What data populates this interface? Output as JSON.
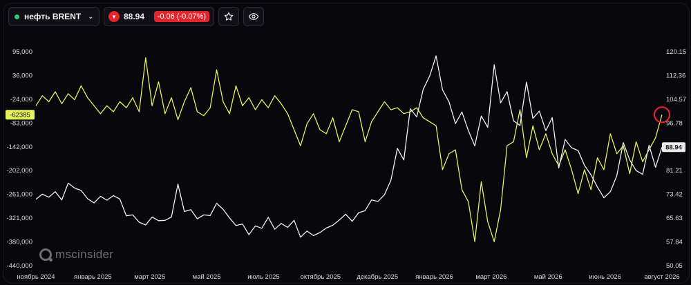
{
  "instrument": {
    "name": "нефть BRENT",
    "status_color": "#2ecc71"
  },
  "quote": {
    "price": "88.94",
    "change": "-0.06 (-0.07%)",
    "direction": "down",
    "down_color": "#e0262c"
  },
  "actions": {
    "favorite_icon": "star-icon",
    "watch_icon": "eye-icon"
  },
  "watermark": "mscinsider",
  "chart_data": {
    "type": "line",
    "x": [
      "ноябрь 2024",
      "январь 2025",
      "март 2025",
      "май 2025",
      "июль 2025",
      "октябрь 2025",
      "декабрь 2025",
      "январь 2026",
      "март 2026",
      "май 2026",
      "июнь 2026",
      "август 2026"
    ],
    "left_axis": {
      "ticks": [
        "95,000",
        "36,000",
        "-24,000",
        "-83,000",
        "-142,000",
        "-202,000",
        "-261,000",
        "-321,000",
        "-380,000",
        "-440,000"
      ],
      "ylim": [
        -440000,
        95000
      ],
      "marker": "-62385"
    },
    "right_axis": {
      "ticks": [
        "120.15",
        "112.36",
        "104.57",
        "96.78",
        "89.00",
        "81.21",
        "73.42",
        "65.63",
        "57.84",
        "50.05"
      ],
      "ylim": [
        50.05,
        120.15
      ],
      "last_price": "88.94"
    },
    "series": [
      {
        "axis": "left",
        "color": "#e6f05a",
        "values": [
          -40000,
          -15000,
          -30000,
          -5000,
          -35000,
          -10000,
          -25000,
          10000,
          -20000,
          -40000,
          -60000,
          -40000,
          -55000,
          -30000,
          -45000,
          -20000,
          -55000,
          80000,
          -40000,
          20000,
          -60000,
          -20000,
          -75000,
          -30000,
          5000,
          -55000,
          -65000,
          -45000,
          50000,
          -30000,
          -60000,
          10000,
          -40000,
          -20000,
          -50000,
          -25000,
          -45000,
          -15000,
          -35000,
          -60000,
          -100000,
          -140000,
          -85000,
          -60000,
          -100000,
          -110000,
          -70000,
          -130000,
          -90000,
          -50000,
          -55000,
          -130000,
          -80000,
          -55000,
          -30000,
          -50000,
          -45000,
          -60000,
          -55000,
          -45000,
          -70000,
          -80000,
          -90000,
          -200000,
          -160000,
          -150000,
          -250000,
          -280000,
          -380000,
          -230000,
          -330000,
          -380000,
          -300000,
          -140000,
          -130000,
          -50000,
          -170000,
          -90000,
          -150000,
          -110000,
          -160000,
          -190000,
          -150000,
          -200000,
          -260000,
          -200000,
          -250000,
          -170000,
          -200000,
          -110000,
          -160000,
          -140000,
          -210000,
          -130000,
          -180000,
          -150000,
          -120000,
          -62385
        ]
      },
      {
        "axis": "right",
        "color": "#f0f0f0",
        "values": [
          71.8,
          73.5,
          72.5,
          74.3,
          71.6,
          77.1,
          75.5,
          74.7,
          72.0,
          70.6,
          72.8,
          71.5,
          73.0,
          71.9,
          66.4,
          66.7,
          64.3,
          63.4,
          66.0,
          64.8,
          64.9,
          66.0,
          76.8,
          67.8,
          68.4,
          65.4,
          66.7,
          66.5,
          70.5,
          68.5,
          65.7,
          63.2,
          63.7,
          60.2,
          63.1,
          62.3,
          65.9,
          62.0,
          63.9,
          62.6,
          64.9,
          59.4,
          61.4,
          59.9,
          60.9,
          62.4,
          63.3,
          65.0,
          66.9,
          64.6,
          67.4,
          68.1,
          71.6,
          71.1,
          73.3,
          78.0,
          88.5,
          84.7,
          101.5,
          98.8,
          107.8,
          112.2,
          118.8,
          107.7,
          103.7,
          96.6,
          100.4,
          94.3,
          89.3,
          99.1,
          95.4,
          115.9,
          103.4,
          107.1,
          97.5,
          96.0,
          110.2,
          98.3,
          100.7,
          94.3,
          98.6,
          82.1,
          91.4,
          88.7,
          87.8,
          82.9,
          79.8,
          75.8,
          72.3,
          74.3,
          79.5,
          90.4,
          84.7,
          81.2,
          80.0,
          89.5,
          82.3,
          88.9
        ]
      }
    ]
  }
}
